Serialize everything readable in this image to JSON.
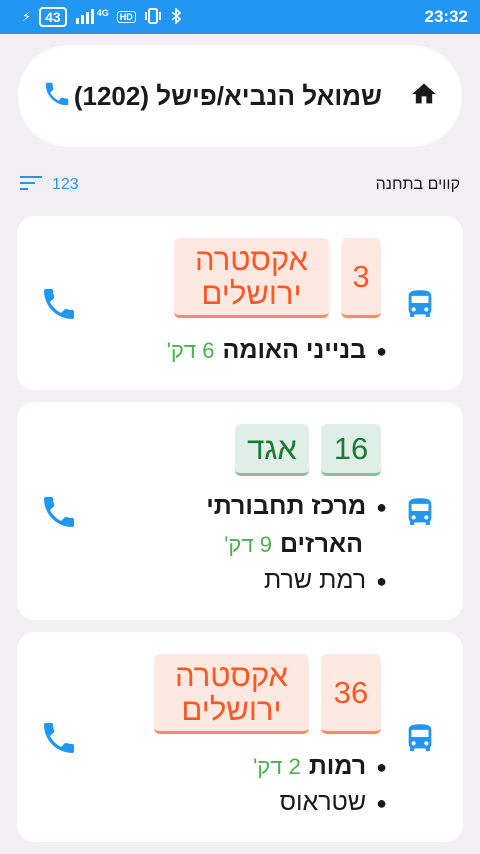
{
  "status_bar": {
    "battery": "43",
    "network": "4G",
    "hd": "HD",
    "time": "23:32"
  },
  "station": {
    "title": "שמואל הנביא/פישל (1202)"
  },
  "lines_section": {
    "title": "קווים בתחנה",
    "count": "123"
  },
  "lines": [
    {
      "number": "3",
      "operator": "אקסטרה ירושלים",
      "color": "#ff5722",
      "stops": [
        {
          "name": "בנייני האומה",
          "eta": "6 דק'"
        }
      ]
    },
    {
      "number": "16",
      "operator": "אגד",
      "color": "#1b7a33",
      "stops": [
        {
          "name": "מרכז תחבורתי",
          "eta": ""
        },
        {
          "name": "הארזים",
          "eta": "9 דק'"
        },
        {
          "name": "רמת שרת",
          "eta": ""
        }
      ]
    },
    {
      "number": "36",
      "operator": "אקסטרה ירושלים",
      "color": "#ff5722",
      "stops": [
        {
          "name": "רמות",
          "eta": "2 דק'"
        },
        {
          "name": "שטראוס",
          "eta": ""
        }
      ]
    }
  ],
  "colors": {
    "accent": "#2196f3",
    "eta": "#4caf50"
  },
  "icons": {
    "home": "home-icon",
    "phone": "phone-icon",
    "bus": "bus-icon",
    "sort": "sort-icon"
  }
}
